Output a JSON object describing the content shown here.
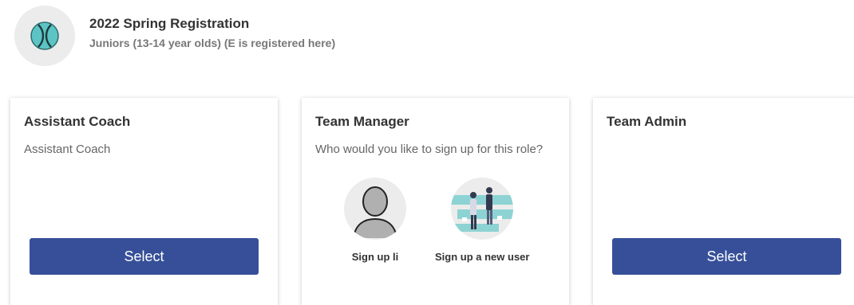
{
  "header": {
    "logo_icon": "baseball-icon",
    "title": "2022 Spring Registration",
    "subtitle": "Juniors (13-14 year olds) (E is registered here)"
  },
  "cards": [
    {
      "title": "Assistant Coach",
      "description": "Assistant Coach",
      "button": "Select"
    },
    {
      "title": "Team Manager",
      "description": "Who would you like to sign up for this role?",
      "options": [
        {
          "label": "Sign up li",
          "icon": "default-avatar-icon"
        },
        {
          "label": "Sign up a new user",
          "icon": "new-user-illustration-icon"
        }
      ]
    },
    {
      "title": "Team Admin",
      "button": "Select"
    }
  ],
  "colors": {
    "button": "#364f98",
    "ball": "#5cc4c4"
  }
}
